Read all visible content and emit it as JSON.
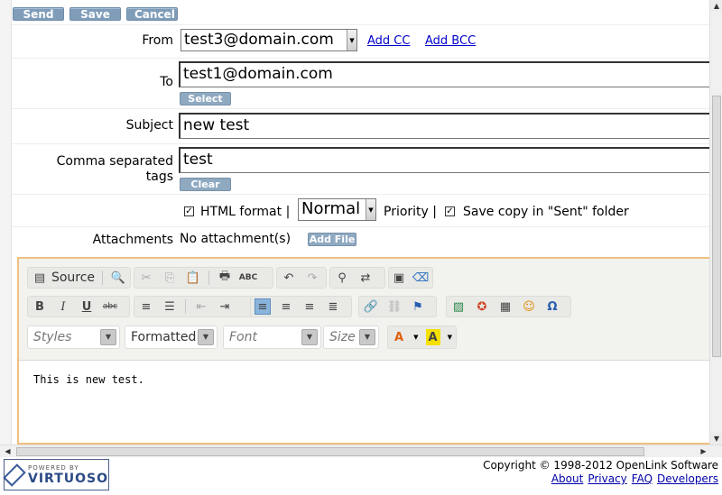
{
  "actions": {
    "send": "Send",
    "save": "Save",
    "cancel": "Cancel"
  },
  "from": {
    "label": "From",
    "value": "test3@domain.com",
    "add_cc": "Add CC",
    "add_bcc": "Add BCC"
  },
  "to": {
    "label": "To",
    "value": "test1@domain.com",
    "select_btn": "Select"
  },
  "subject": {
    "label": "Subject",
    "value": "new test"
  },
  "tags": {
    "label_line1": "Comma separated",
    "label_line2": "tags",
    "value": "test",
    "clear_btn": "Clear"
  },
  "options": {
    "html_checked": true,
    "html_label": "HTML format |",
    "priority_value": "Normal",
    "priority_label": "Priority |",
    "save_copy_checked": true,
    "save_copy_label": "Save copy in \"Sent\" folder"
  },
  "attachments": {
    "label": "Attachments",
    "value": "No attachment(s)",
    "add_file_btn": "Add File"
  },
  "editor": {
    "source_label": "Source",
    "styles_placeholder": "Styles",
    "format_value": "Formatted",
    "font_placeholder": "Font",
    "size_placeholder": "Size",
    "content": "This is new test."
  },
  "footer": {
    "logo_small": "POWERED BY",
    "logo_big": "VIRTUOSO",
    "copyright": "Copyright © 1998-2012 OpenLink Software",
    "links": [
      "About",
      "Privacy",
      "FAQ",
      "Developers"
    ]
  },
  "colors": {
    "button": "#7f9db9",
    "editor_border": "#f0c080",
    "link": "#0000cc"
  }
}
